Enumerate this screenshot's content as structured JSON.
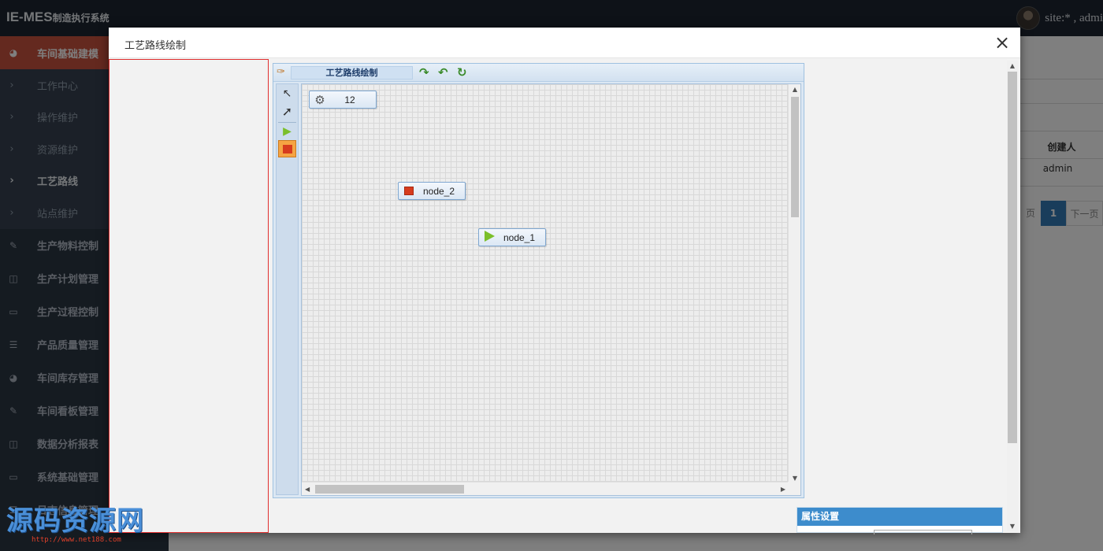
{
  "header": {
    "brand_main": "IE-MES",
    "brand_sub": "制造执行系统",
    "user_label": "site:* , admi"
  },
  "sidebar": {
    "items": [
      {
        "label": "车间基础建模",
        "icon": "dashboard-icon",
        "active": true
      },
      {
        "label": "工作中心",
        "sub": true
      },
      {
        "label": "操作维护",
        "sub": true
      },
      {
        "label": "资源维护",
        "sub": true
      },
      {
        "label": "工艺路线",
        "sub": true,
        "current": true
      },
      {
        "label": "站点维护",
        "sub": true
      },
      {
        "label": "生产物料控制",
        "icon": "edit-icon"
      },
      {
        "label": "生产计划管理",
        "icon": "columns-icon"
      },
      {
        "label": "生产过程控制",
        "icon": "book-icon"
      },
      {
        "label": "产品质量管理",
        "icon": "list-icon"
      },
      {
        "label": "车间库存管理",
        "icon": "dashboard-icon"
      },
      {
        "label": "车间看板管理",
        "icon": "edit-icon"
      },
      {
        "label": "数据分析报表",
        "icon": "columns-icon"
      },
      {
        "label": "系统基础管理",
        "icon": "book-icon"
      },
      {
        "label": "日志信息管理",
        "icon": "list-icon"
      }
    ]
  },
  "background": {
    "col_header": "创建人",
    "cell_value": "admin",
    "pagination": {
      "prev_fragment": "页",
      "current": "1",
      "next": "下一页"
    }
  },
  "modal": {
    "title": "工艺路线绘制",
    "designer": {
      "title": "工艺路线绘制",
      "nodes": [
        {
          "id": "gear-node",
          "label": "12",
          "type": "task"
        },
        {
          "id": "node_2",
          "label": "node_2",
          "type": "end"
        },
        {
          "id": "node_1",
          "label": "node_1",
          "type": "start"
        }
      ]
    },
    "property_panel": {
      "title": "属性设置"
    }
  },
  "watermark": {
    "text": "源码资源网",
    "url": "http://www.net188.com"
  }
}
